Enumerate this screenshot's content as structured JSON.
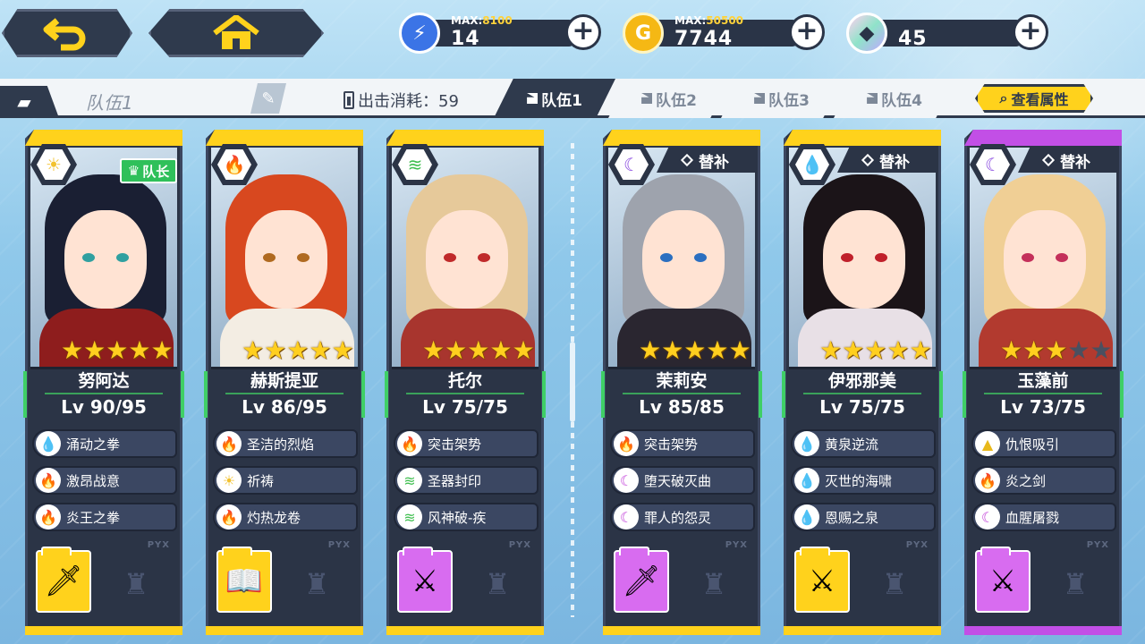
{
  "header": {
    "back_icon": "back-arrow-icon",
    "home_icon": "home-icon",
    "resources": [
      {
        "name": "stamina",
        "icon": "battery-icon",
        "max_label": "MAX:",
        "max": "8100",
        "value": "14",
        "color": "#3b74e6"
      },
      {
        "name": "gold",
        "icon": "coin-icon",
        "max_label": "MAX:",
        "max": "50500",
        "value": "7744",
        "color": "#f5b814"
      },
      {
        "name": "crystal",
        "icon": "crystal-icon",
        "max_label": "",
        "max": "",
        "value": "45",
        "color": "#8fe3c9"
      }
    ]
  },
  "teambar": {
    "team_name": "队伍1",
    "cost_label": "出击消耗：59",
    "tabs": [
      "队伍1",
      "队伍2",
      "队伍3",
      "队伍4"
    ],
    "active_tab": 0,
    "attr_button": "查看属性"
  },
  "cards": [
    {
      "element": "sun",
      "elem_glyph": "☀",
      "elem_color": "#f2c230",
      "strip": "#ffd21c",
      "tag": "队长",
      "name": "努阿达",
      "level": "Lv 90/95",
      "stars": 5,
      "hair": "#1a1f33",
      "outfit": "#8e1d1d",
      "eye": "#30a0a0",
      "skills": [
        {
          "icon": "water",
          "glyph": "💧",
          "color": "#2f8fe6",
          "name": "涌动之拳"
        },
        {
          "icon": "fire",
          "glyph": "🔥",
          "color": "#e23b3b",
          "name": "激昂战意"
        },
        {
          "icon": "fire",
          "glyph": "🔥",
          "color": "#e23b3b",
          "name": "炎王之拳"
        }
      ],
      "weapon": {
        "frame": "#ffd21c",
        "glyph": "🗡"
      }
    },
    {
      "element": "fire",
      "elem_glyph": "🔥",
      "elem_color": "#e23b3b",
      "strip": "#ffd21c",
      "tag": "",
      "name": "赫斯提亚",
      "level": "Lv 86/95",
      "stars": 5,
      "hair": "#d8481f",
      "outfit": "#f3ede3",
      "eye": "#b06a20",
      "skills": [
        {
          "icon": "fire",
          "glyph": "🔥",
          "color": "#e23b3b",
          "name": "圣洁的烈焰"
        },
        {
          "icon": "sun",
          "glyph": "☀",
          "color": "#f2c230",
          "name": "祈祷"
        },
        {
          "icon": "fire",
          "glyph": "🔥",
          "color": "#e23b3b",
          "name": "灼热龙卷"
        }
      ],
      "weapon": {
        "frame": "#ffd21c",
        "glyph": "📖"
      }
    },
    {
      "element": "wind",
      "elem_glyph": "≋",
      "elem_color": "#3fbf4f",
      "strip": "#ffd21c",
      "tag": "",
      "name": "托尔",
      "level": "Lv 75/75",
      "stars": 5,
      "hair": "#e6c99a",
      "outfit": "#a8352e",
      "eye": "#c02a2a",
      "skills": [
        {
          "icon": "fire",
          "glyph": "🔥",
          "color": "#e23b3b",
          "name": "突击架势"
        },
        {
          "icon": "wind",
          "glyph": "≋",
          "color": "#3fbf4f",
          "name": "圣器封印"
        },
        {
          "icon": "wind",
          "glyph": "≋",
          "color": "#3fbf4f",
          "name": "风神破-疾"
        }
      ],
      "weapon": {
        "frame": "#d86cf0",
        "glyph": "⚔"
      }
    },
    {
      "element": "moon",
      "elem_glyph": "☾",
      "elem_color": "#8a4be0",
      "strip": "#ffd21c",
      "tag": "替补",
      "name": "茉莉安",
      "level": "Lv 85/85",
      "stars": 5,
      "hair": "#9ea3ad",
      "outfit": "#2a2630",
      "eye": "#2b6fc0",
      "skills": [
        {
          "icon": "fire",
          "glyph": "🔥",
          "color": "#e23b3b",
          "name": "突击架势"
        },
        {
          "icon": "moon",
          "glyph": "☾",
          "color": "#c23fd9",
          "name": "堕天破灭曲"
        },
        {
          "icon": "moon",
          "glyph": "☾",
          "color": "#c23fd9",
          "name": "罪人的怨灵"
        }
      ],
      "weapon": {
        "frame": "#d86cf0",
        "glyph": "🗡"
      }
    },
    {
      "element": "water",
      "elem_glyph": "💧",
      "elem_color": "#2f8fe6",
      "strip": "#ffd21c",
      "tag": "替补",
      "name": "伊邪那美",
      "level": "Lv 75/75",
      "stars": 5,
      "hair": "#1b1418",
      "outfit": "#e8e0e6",
      "eye": "#c0202a",
      "skills": [
        {
          "icon": "water",
          "glyph": "💧",
          "color": "#2f8fe6",
          "name": "黄泉逆流"
        },
        {
          "icon": "water",
          "glyph": "💧",
          "color": "#2f8fe6",
          "name": "灭世的海啸"
        },
        {
          "icon": "water",
          "glyph": "💧",
          "color": "#2f8fe6",
          "name": "恩赐之泉"
        }
      ],
      "weapon": {
        "frame": "#ffd21c",
        "glyph": "⚔"
      }
    },
    {
      "element": "moon",
      "elem_glyph": "☾",
      "elem_color": "#8a4be0",
      "strip": "#c24fe6",
      "tag": "替补",
      "name": "玉藻前",
      "level": "Lv 73/75",
      "stars": 3,
      "hair": "#f0cf95",
      "outfit": "#b23a2f",
      "eye": "#c4305a",
      "skills": [
        {
          "icon": "earth",
          "glyph": "▲",
          "color": "#e8b81a",
          "name": "仇恨吸引"
        },
        {
          "icon": "fire",
          "glyph": "🔥",
          "color": "#e23b3b",
          "name": "炎之剑"
        },
        {
          "icon": "moon",
          "glyph": "☾",
          "color": "#c23fd9",
          "name": "血腥屠戮"
        }
      ],
      "weapon": {
        "frame": "#d86cf0",
        "glyph": "⚔"
      }
    }
  ],
  "watermark": "PYX"
}
